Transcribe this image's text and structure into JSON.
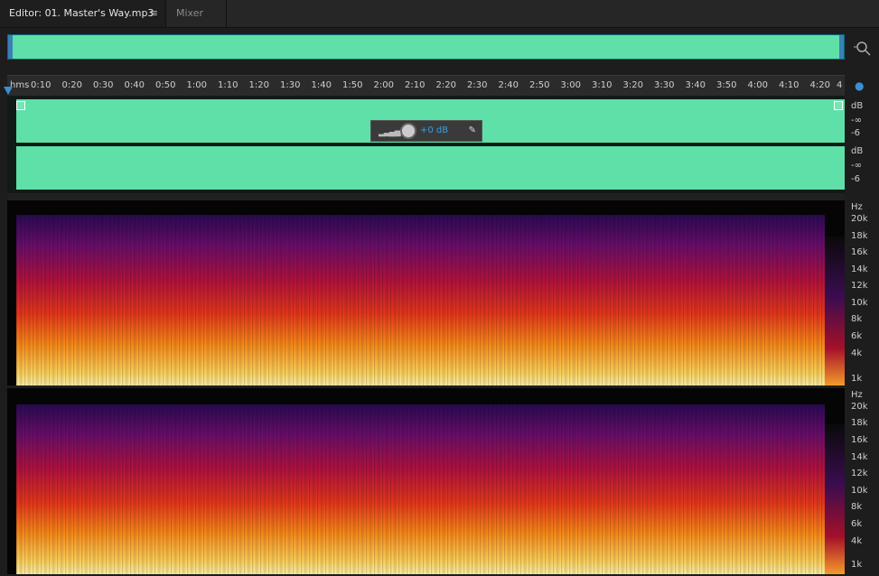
{
  "tabs": {
    "editor_label": "Editor: 01. Master's Way.mp3",
    "menu_icon": "≡",
    "mixer_label": "Mixer"
  },
  "ruler": {
    "unit": "hms",
    "labels": [
      "0:10",
      "0:20",
      "0:30",
      "0:40",
      "0:50",
      "1:00",
      "1:10",
      "1:20",
      "1:30",
      "1:40",
      "1:50",
      "2:00",
      "2:10",
      "2:20",
      "2:30",
      "2:40",
      "2:50",
      "3:00",
      "3:10",
      "3:20",
      "3:30",
      "3:40",
      "3:50",
      "4:00",
      "4:10",
      "4:20",
      "4"
    ]
  },
  "hud": {
    "volume": "+0 dB",
    "pin_icon": "pin-icon"
  },
  "db_scale": {
    "channel1": [
      "dB",
      "-∞",
      "-6"
    ],
    "channel2": [
      "dB",
      "-∞",
      "-6"
    ]
  },
  "hz_scale": {
    "channel1": [
      "Hz",
      "20k",
      "18k",
      "16k",
      "14k",
      "12k",
      "10k",
      "8k",
      "6k",
      "4k",
      "1k"
    ],
    "channel2": [
      "Hz",
      "20k",
      "18k",
      "16k",
      "14k",
      "12k",
      "10k",
      "8k",
      "6k",
      "4k",
      "1k"
    ]
  },
  "colors": {
    "waveform": "#5ee0a8",
    "accent": "#3b8fd6",
    "background": "#1d1d1d"
  },
  "icons": [
    "menu-icon",
    "zoom-icon",
    "playhead-icon",
    "monitor-icon",
    "pin-icon",
    "volume-knob-icon"
  ]
}
